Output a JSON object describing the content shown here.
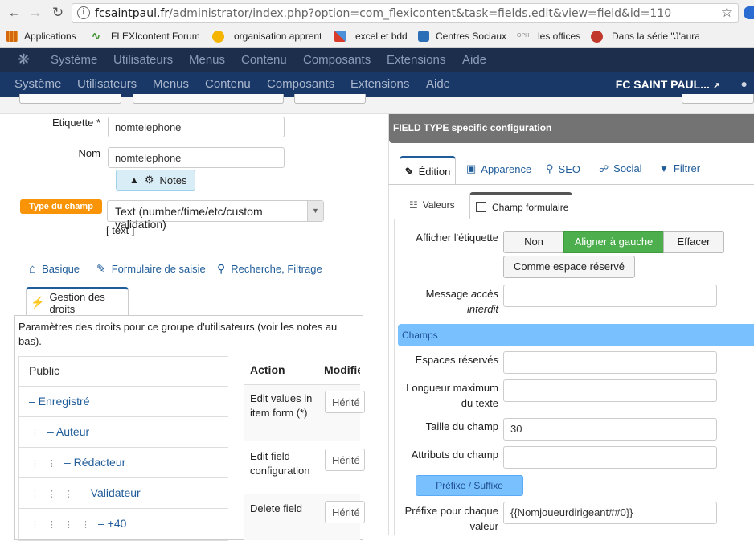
{
  "browser": {
    "url_host": "fcsaintpaul.fr",
    "url_path": "/administrator/index.php?option=com_flexicontent&task=fields.edit&view=field&id=110",
    "bookmarks": [
      {
        "label": "Applications",
        "icon": "apps-grid-icon",
        "color": "#e9a23b"
      },
      {
        "label": "FLEXIcontent Forum",
        "icon": "flexi-logo-icon",
        "color": "#3a8f2a"
      },
      {
        "label": "organisation apprent",
        "icon": "circle-icon",
        "color": "#f4b400"
      },
      {
        "label": "excel et bdd",
        "icon": "puzzle-icon",
        "color": "#d93c2b"
      },
      {
        "label": "Centres Sociaux",
        "icon": "cs-logo-icon",
        "color": "#2d6fb7"
      },
      {
        "label": "les offices",
        "icon": "oph-logo-icon",
        "color": "#888888"
      },
      {
        "label": "Dans la série \"J'aurai",
        "icon": "red-circle-icon",
        "color": "#c0392b"
      }
    ]
  },
  "joomla": {
    "menu_top": [
      "Système",
      "Utilisateurs",
      "Menus",
      "Contenu",
      "Composants",
      "Extensions",
      "Aide"
    ],
    "menu_main": [
      "Système",
      "Utilisateurs",
      "Menus",
      "Contenu",
      "Composants",
      "Extensions",
      "Aide"
    ],
    "site_name": "FC SAINT PAUL..."
  },
  "form": {
    "etiquette_label": "Etiquette",
    "required_mark": "*",
    "etiquette_value": "nomtelephone",
    "nom_label": "Nom",
    "nom_value": "nomtelephone",
    "notes_label": "Notes",
    "type_label": "Type du champ",
    "type_value": "Text (number/time/etc/custom validation)",
    "type_hint": "[ text ]"
  },
  "left_tabs": {
    "basique": "Basique",
    "formulaire": "Formulaire de saisie",
    "recherche": "Recherche, Filtrage",
    "droits": "Gestion des droits"
  },
  "permissions": {
    "description": "Paramètres des droits pour ce groupe d'utilisateurs (voir les notes au bas).",
    "groups": [
      "Public",
      "– Enregistré",
      "– Auteur",
      "– Rédacteur",
      "– Validateur",
      "– +40"
    ],
    "col_action": "Action",
    "col_modify": "Modifie",
    "actions": [
      {
        "label": "Edit values in item form (*)",
        "value": "Hérité"
      },
      {
        "label": "Edit field configuration",
        "value": "Hérité"
      },
      {
        "label": "Delete field",
        "value": "Hérité"
      }
    ]
  },
  "right": {
    "header": "FIELD TYPE specific configuration",
    "tabs": [
      "Édition",
      "Apparence",
      "SEO",
      "Social",
      "Filtrer"
    ],
    "subtabs": [
      "Valeurs",
      "Champ formulaire"
    ],
    "afficher_label": "Afficher l'étiquette",
    "seg_options": [
      "Non",
      "Aligner à gauche",
      "Effacer"
    ],
    "seg_selected": "Aligner à gauche",
    "placeholder_btn": "Comme espace réservé",
    "message_label_1": "Message",
    "message_label_2": "accès",
    "message_label_3": "interdit",
    "section": "Champs",
    "espaces_label": "Espaces réservés",
    "longueur_label": "Longueur maximum du texte",
    "taille_label": "Taille du champ",
    "taille_value": "30",
    "attributs_label": "Attributs du champ",
    "prefix_suffix_btn": "Préfixe / Suffixe",
    "prefixe_label": "Préfixe pour chaque valeur",
    "prefixe_value": "{{Nomjoueurdirigeant##0}}"
  },
  "colors": {
    "joomla_top": "#1c2e4b",
    "joomla_bar": "#1a3867",
    "accent_green": "#4cae4c",
    "badge_orange": "#f89406",
    "section_blue": "#79c0ff",
    "link_blue": "#1f5c99"
  }
}
